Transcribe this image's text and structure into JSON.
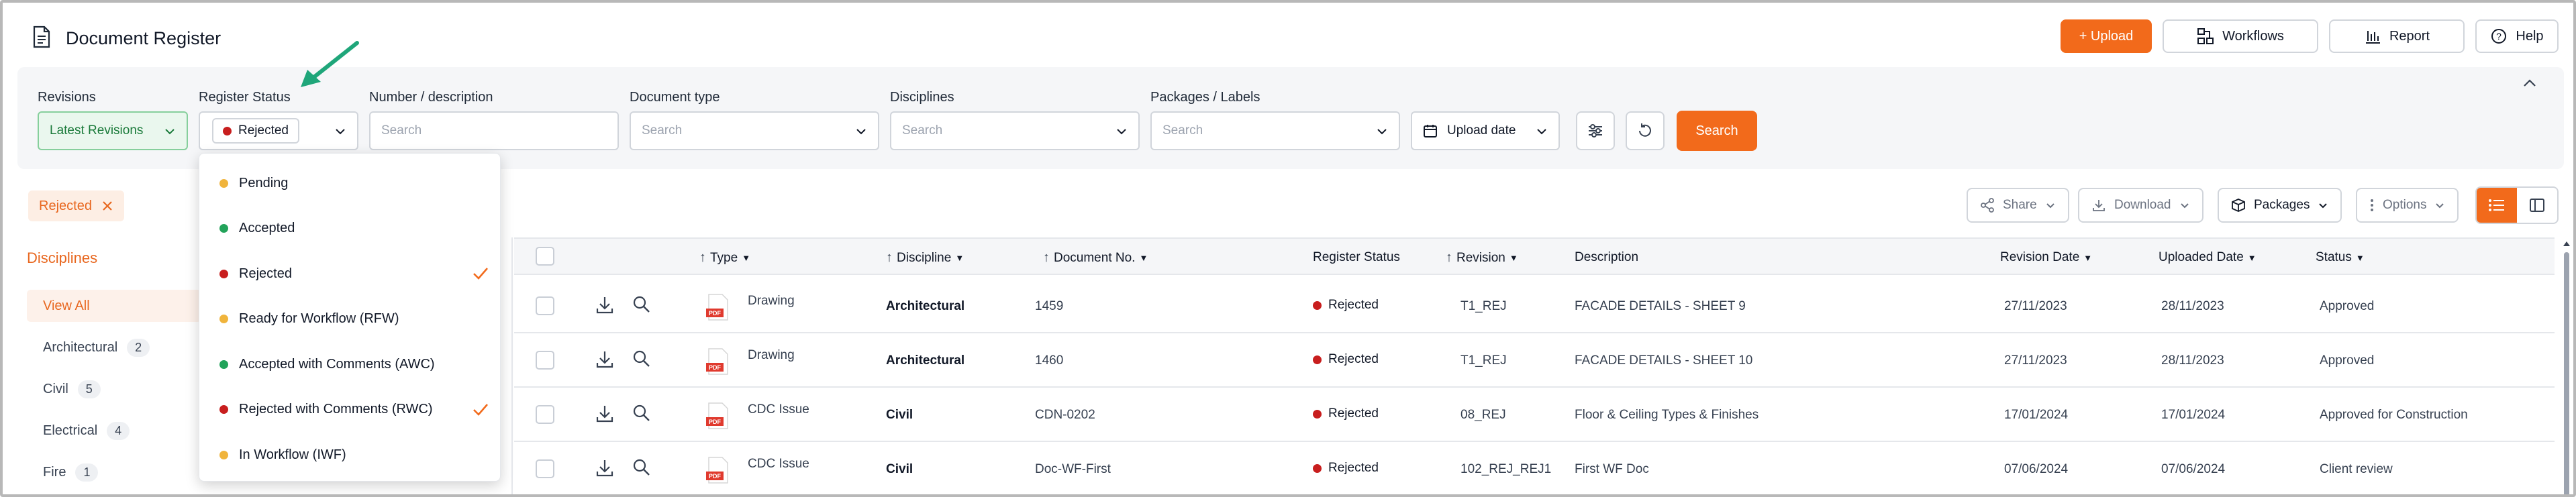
{
  "header": {
    "title": "Document Register",
    "buttons": {
      "upload": "+ Upload",
      "workflows": "Workflows",
      "report": "Report",
      "help": "Help"
    }
  },
  "filters": {
    "revisions": {
      "label": "Revisions",
      "value": "Latest Revisions"
    },
    "register_status": {
      "label": "Register Status",
      "value": "Rejected"
    },
    "number": {
      "label": "Number / description",
      "placeholder": "Search"
    },
    "doc_type": {
      "label": "Document type",
      "placeholder": "Search"
    },
    "disciplines": {
      "label": "Disciplines",
      "placeholder": "Search"
    },
    "packages": {
      "label": "Packages / Labels",
      "placeholder": "Search"
    },
    "upload_date": "Upload date",
    "search_button": "Search"
  },
  "active_chip": "Rejected",
  "toolbar": {
    "share": "Share",
    "download": "Download",
    "packages": "Packages",
    "options": "Options"
  },
  "sidebar": {
    "title": "Disciplines",
    "items": [
      {
        "label": "View All",
        "count": ""
      },
      {
        "label": "Architectural",
        "count": "2"
      },
      {
        "label": "Civil",
        "count": "5"
      },
      {
        "label": "Electrical",
        "count": "4"
      },
      {
        "label": "Fire",
        "count": "1"
      }
    ]
  },
  "dropdown": {
    "items": [
      {
        "label": "Pending",
        "color": "#f0b43c",
        "checked": false
      },
      {
        "label": "Accepted",
        "color": "#22a35a",
        "checked": false
      },
      {
        "label": "Rejected",
        "color": "#c81e1e",
        "checked": true
      },
      {
        "label": "Ready for Workflow (RFW)",
        "color": "#f0b43c",
        "checked": false
      },
      {
        "label": "Accepted with Comments (AWC)",
        "color": "#22a35a",
        "checked": false
      },
      {
        "label": "Rejected with Comments (RWC)",
        "color": "#c81e1e",
        "checked": true
      },
      {
        "label": "In Workflow (IWF)",
        "color": "#f0b43c",
        "checked": false
      }
    ]
  },
  "table": {
    "columns": {
      "type": "Type",
      "discipline": "Discipline",
      "doc_no": "Document No.",
      "register_status": "Register Status",
      "revision": "Revision",
      "description": "Description",
      "revision_date": "Revision Date",
      "uploaded_date": "Uploaded Date",
      "status": "Status"
    },
    "rows": [
      {
        "type": "Drawing",
        "discipline": "Architectural",
        "doc_no": "1459",
        "register_status": "Rejected",
        "revision": "T1_REJ",
        "description": "FACADE DETAILS - SHEET 9",
        "revision_date": "27/11/2023",
        "uploaded_date": "28/11/2023",
        "status": "Approved"
      },
      {
        "type": "Drawing",
        "discipline": "Architectural",
        "doc_no": "1460",
        "register_status": "Rejected",
        "revision": "T1_REJ",
        "description": "FACADE DETAILS - SHEET 10",
        "revision_date": "27/11/2023",
        "uploaded_date": "28/11/2023",
        "status": "Approved"
      },
      {
        "type": "CDC Issue",
        "discipline": "Civil",
        "doc_no": "CDN-0202",
        "register_status": "Rejected",
        "revision": "08_REJ",
        "description": "Floor & Ceiling Types & Finishes",
        "revision_date": "17/01/2024",
        "uploaded_date": "17/01/2024",
        "status": "Approved for Construction"
      },
      {
        "type": "CDC Issue",
        "discipline": "Civil",
        "doc_no": "Doc-WF-First",
        "register_status": "Rejected",
        "revision": "102_REJ_REJ1",
        "description": "First WF Doc",
        "revision_date": "07/06/2024",
        "uploaded_date": "07/06/2024",
        "status": "Client review"
      }
    ]
  },
  "colors": {
    "accent": "#f26a1b",
    "rejected": "#c81e1e",
    "accepted": "#22a35a",
    "pending": "#f0b43c",
    "annotation_arrow": "#1fa67a"
  }
}
